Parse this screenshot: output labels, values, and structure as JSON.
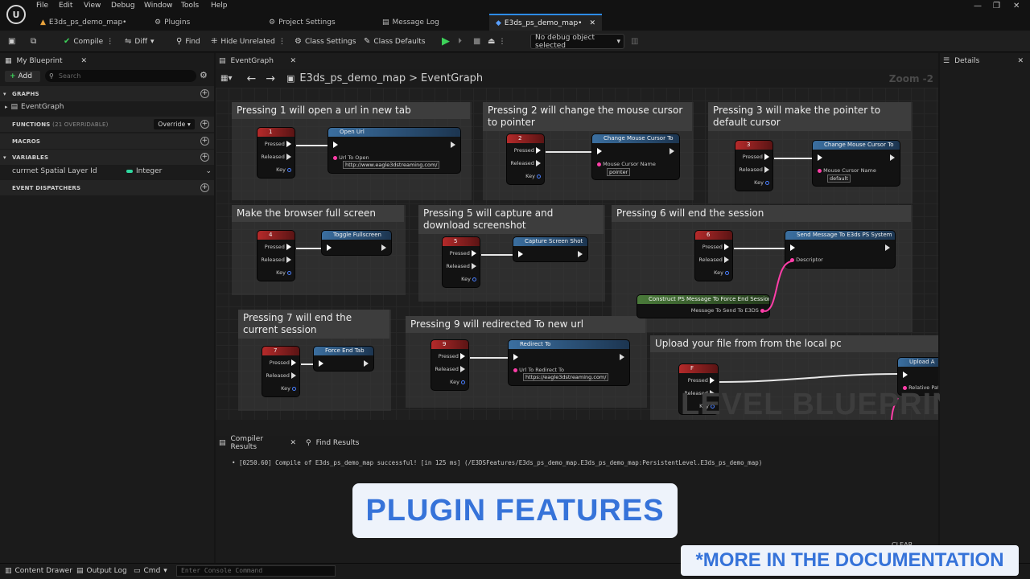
{
  "menu": [
    "File",
    "Edit",
    "View",
    "Debug",
    "Window",
    "Tools",
    "Help"
  ],
  "doc_tabs": [
    {
      "label": "E3ds_ps_demo_map•"
    },
    {
      "label": "Plugins"
    },
    {
      "label": "Project Settings"
    },
    {
      "label": "Message Log"
    },
    {
      "label": "E3ds_ps_demo_map•"
    }
  ],
  "toolbar": {
    "compile": "Compile",
    "diff": "Diff",
    "find": "Find",
    "hide_unrelated": "Hide Unrelated",
    "class_settings": "Class Settings",
    "class_defaults": "Class Defaults",
    "debug_object": "No debug object selected"
  },
  "my_blueprint": {
    "tab": "My Blueprint",
    "add": "Add",
    "search_placeholder": "Search",
    "graphs": "GRAPHS",
    "event_graph": "EventGraph",
    "functions": "FUNCTIONS",
    "functions_count": "(21 OVERRIDABLE)",
    "override": "Override",
    "macros": "MACROS",
    "variables": "VARIABLES",
    "var_name": "currnet Spatial Layer Id",
    "var_type": "Integer",
    "dispatchers": "EVENT DISPATCHERS"
  },
  "graph": {
    "tab": "EventGraph",
    "breadcrumb_map": "E3ds_ps_demo_map",
    "breadcrumb_sep": ">",
    "breadcrumb_graph": "EventGraph",
    "zoom": "Zoom -2",
    "watermark": "LEVEL BLUEPRINT"
  },
  "comments": [
    "Pressing 1 will open a url in new tab",
    "Pressing 2 will change the mouse cursor to pointer",
    "Pressing 3 will make the pointer to default cursor",
    "Make the browser full screen",
    "Pressing 5 will capture and download screenshot",
    "Pressing 6 will end the session",
    "Pressing 7 will end the current session",
    "Pressing 9 will redirected To new url",
    "Upload your file from from the local pc"
  ],
  "pins": {
    "pressed": "Pressed",
    "released": "Released",
    "key": "Key"
  },
  "nodes": {
    "k1": "1",
    "open_url": "Open Url",
    "url_to_open": "Url To Open",
    "url_value": "http://www.eagle3dstreaming.com/",
    "k2": "2",
    "change_cursor": "Change Mouse Cursor To",
    "cursor_name": "Mouse Cursor Name",
    "cursor_pointer": "pointer",
    "k3": "3",
    "cursor_default": "default",
    "k4": "4",
    "toggle_fullscreen": "Toggle Fullscreen",
    "k5": "5",
    "capture": "Capture Screen Shot",
    "k6": "6",
    "send_msg": "Send Message To E3ds PS System",
    "descriptor": "Descriptor",
    "construct": "Construct PS Message To Force End Session",
    "msg_to_send": "Message To Send To E3DS",
    "k7": "7",
    "force_end": "Force End Tab",
    "k9": "9",
    "redirect": "Redirect To",
    "url_redirect": "Url To Redirect To",
    "redirect_value": "https://eagle3dstreaming.com/",
    "kf": "F",
    "upload": "Upload A",
    "relative": "Relative Pat"
  },
  "details": {
    "tab": "Details"
  },
  "bottom": {
    "compiler_results": "Compiler Results",
    "find_results": "Find Results",
    "log": "[0250.60] Compile of E3ds_ps_demo_map successful! [in 125 ms] (/E3DSFeatures/E3ds_ps_demo_map.E3ds_ps_demo_map:PersistentLevel.E3ds_ps_demo_map)",
    "clear": "CLEAR"
  },
  "status": {
    "content_drawer": "Content Drawer",
    "output_log": "Output Log",
    "cmd": "Cmd",
    "console_placeholder": "Enter Console Command"
  },
  "overlay": {
    "plugin_features": "PLUGIN FEATURES",
    "more_docs": "*MORE IN THE DOCUMENTATION"
  },
  "colors": {
    "accent": "#2d8cf0",
    "banner_text": "#3673d9",
    "banner_bg": "#eef3fb",
    "play": "#3dd35a",
    "key_node": "#b52a2a",
    "func_node": "#3b6fa0"
  }
}
